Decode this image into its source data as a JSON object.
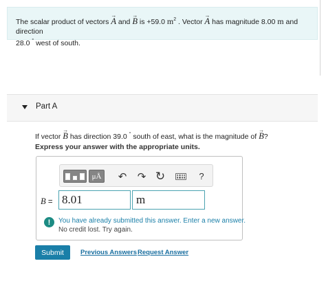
{
  "problem": {
    "t1": "The scalar product of vectors ",
    "vec_a": "A",
    "t2": " and ",
    "vec_b": "B",
    "t3": " is +59.0 ",
    "unit_m": "m",
    "sup2": "2",
    "t4": " . Vector ",
    "vec_a2": "A",
    "t5": " has magnitude 8.00 ",
    "unit_m2": "m",
    "t6": " and direction",
    "t7": "28.0",
    "deg": "°",
    "t8": " west of south."
  },
  "part": {
    "title": "Part A"
  },
  "question": {
    "q1": "If vector ",
    "vec_b": "B",
    "q2": " has direction 39.0 ",
    "deg": "°",
    "q3": " south of east, what is the magnitude of ",
    "vec_b2": "B",
    "q4": "?"
  },
  "instruction": "Express your answer with the appropriate units.",
  "toolbar": {
    "mu_label": "μÅ",
    "undo_icon": "↶",
    "redo_icon": "↷",
    "reset_icon": "↻",
    "help_label": "?"
  },
  "answer": {
    "variable": "B",
    "equals": " =",
    "value": "8.01",
    "units": "m"
  },
  "feedback": {
    "icon": "!",
    "line1": "You have already submitted this answer. Enter a new answer.",
    "line2": "No credit lost. Try again."
  },
  "actions": {
    "submit": "Submit",
    "previous": "Previous Answers",
    "request": "Request Answer"
  }
}
